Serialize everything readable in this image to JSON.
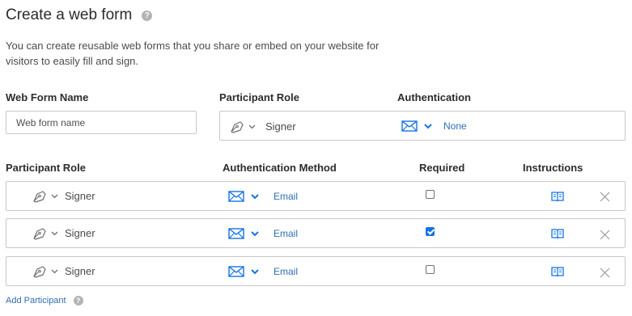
{
  "page": {
    "title": "Create a web form",
    "title_help": "?",
    "description": "You can create reusable web forms that you share or embed on your website for visitors to easily fill and sign."
  },
  "form": {
    "name_label": "Web Form Name",
    "name_placeholder": "Web form name",
    "participant_role_label": "Participant Role",
    "authentication_label": "Authentication",
    "top_role": "Signer",
    "top_auth": "None"
  },
  "table": {
    "headers": {
      "role": "Participant Role",
      "method": "Authentication Method",
      "required": "Required",
      "instructions": "Instructions"
    },
    "rows": [
      {
        "role": "Signer",
        "method": "Email",
        "required": false
      },
      {
        "role": "Signer",
        "method": "Email",
        "required": true
      },
      {
        "role": "Signer",
        "method": "Email",
        "required": false
      }
    ]
  },
  "footer": {
    "add_participant": "Add Participant",
    "help": "?"
  },
  "icons": {
    "role": "pen-nib-icon",
    "dropdown": "chevron-down-icon",
    "auth": "envelope-icon",
    "instructions": "book-icon",
    "remove": "close-icon",
    "help": "help-icon"
  },
  "colors": {
    "accent": "#1473e6",
    "link": "#2d6fb5",
    "border": "#c8c8c8"
  }
}
